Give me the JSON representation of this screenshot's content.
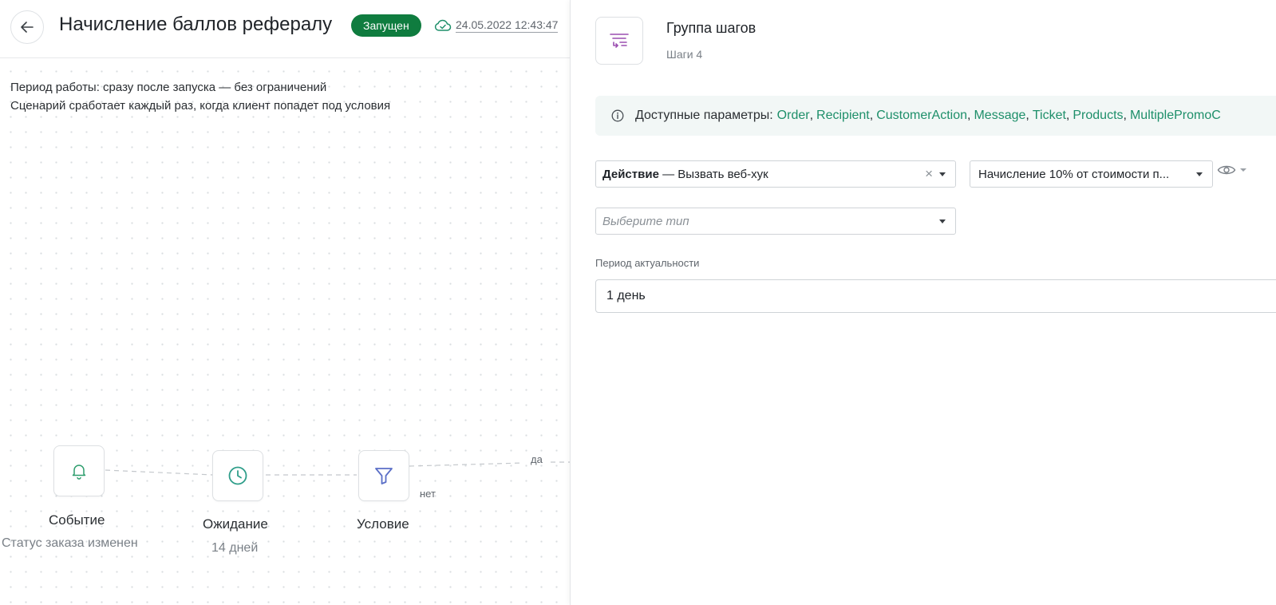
{
  "header": {
    "title": "Начисление баллов рефералу",
    "status": "Запущен",
    "saved_time": "24.05.2022 12:43:47"
  },
  "description": {
    "line1": "Период работы: сразу после запуска — без ограничений",
    "line2": "Сценарий сработает каждый раз, когда клиент попадет под условия"
  },
  "flow": {
    "nodes": [
      {
        "title": "Событие",
        "subtitle": "Статус заказа изменен",
        "icon": "bell-icon"
      },
      {
        "title": "Ожидание",
        "subtitle": "14 дней",
        "icon": "clock-icon"
      },
      {
        "title": "Условие",
        "subtitle": "",
        "icon": "funnel-icon"
      }
    ],
    "edge_yes": "да",
    "edge_no": "нет"
  },
  "panel": {
    "title": "Группа шагов",
    "subtitle": "Шаги 4",
    "params_label": "Доступные параметры:",
    "params": [
      "Order",
      "Recipient",
      "CustomerAction",
      "Message",
      "Ticket",
      "Products",
      "MultiplePromoC"
    ],
    "action_select": {
      "bold": "Действие",
      "rest": " — Вызвать веб-хук"
    },
    "webhook_select": "Начисление 10% от стоимости п...",
    "type_placeholder": "Выберите тип",
    "period_label": "Период актуальности",
    "period_value": "1 день"
  },
  "colors": {
    "accent_green": "#0f7c3f",
    "link_green": "#1e8f6a",
    "group_icon_purple": "#9b4fb0"
  }
}
